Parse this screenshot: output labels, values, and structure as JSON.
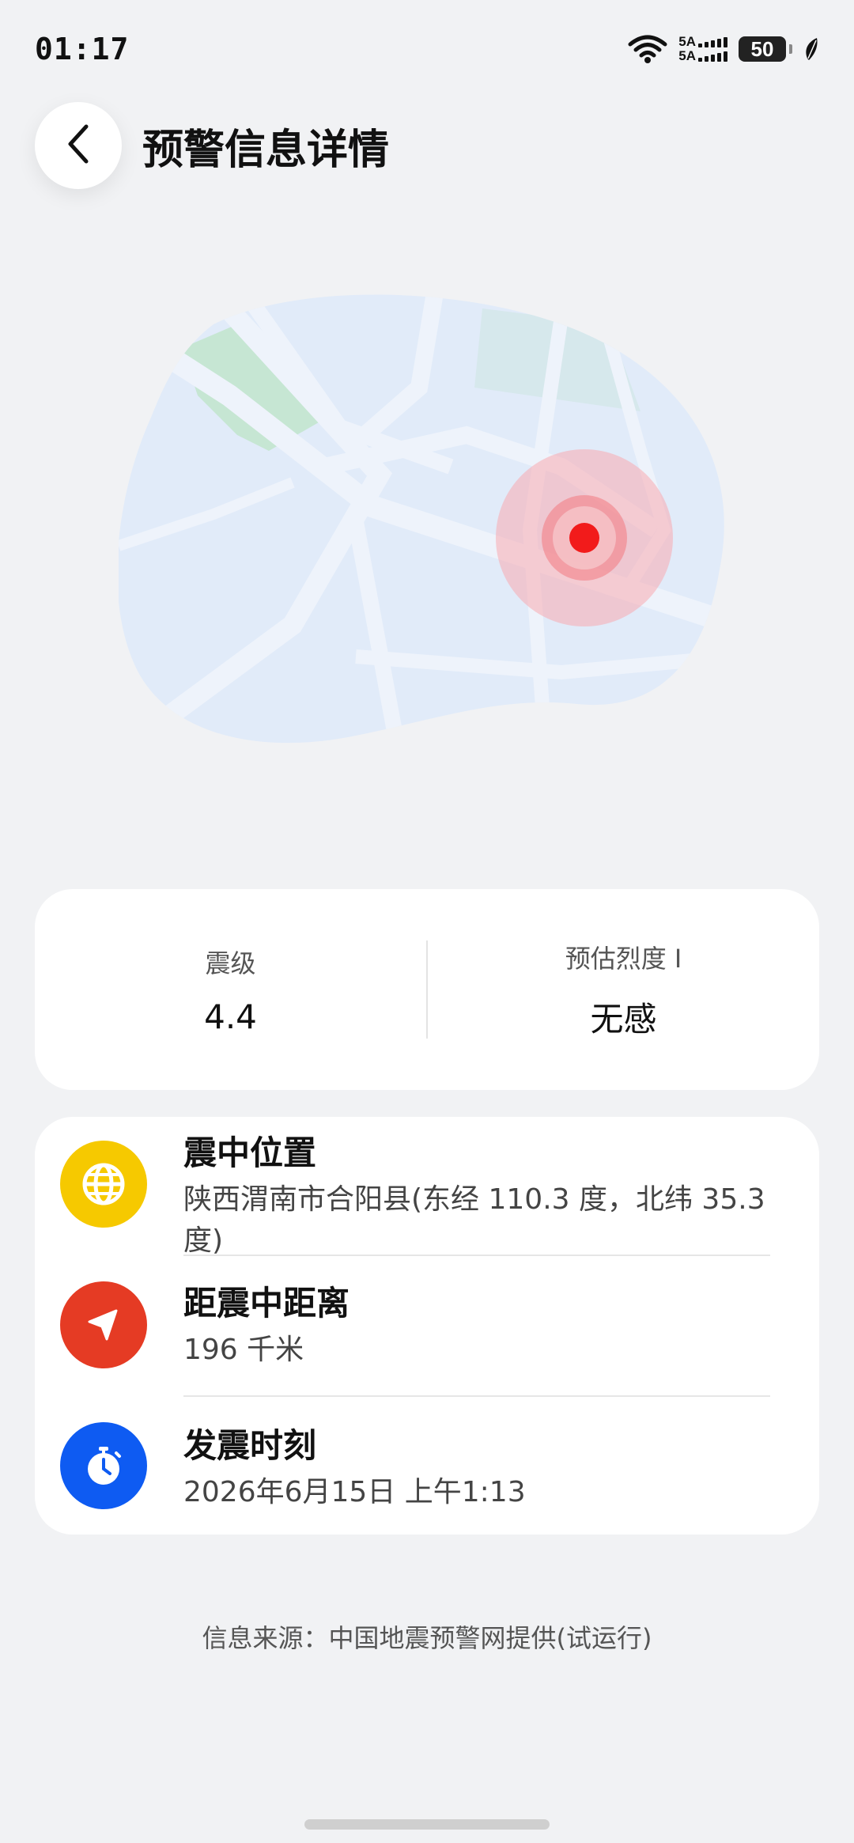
{
  "status_bar": {
    "time": "01:17",
    "signal_1": "5A",
    "signal_2": "5A",
    "battery": "50"
  },
  "header": {
    "title": "预警信息详情"
  },
  "summary": {
    "magnitude_label": "震级",
    "magnitude_value": "4.4",
    "intensity_label": "预估烈度 I",
    "intensity_value": "无感"
  },
  "details": {
    "epicenter_title": "震中位置",
    "epicenter_value": "陕西渭南市合阳县(东经 110.3 度，北纬 35.3 度)",
    "distance_title": "距震中距离",
    "distance_value": "196 千米",
    "time_title": "发震时刻",
    "time_value": "2026年6月15日 上午1:13"
  },
  "footer": {
    "source": "信息来源：中国地震预警网提供(试运行)"
  },
  "colors": {
    "epicenter_icon_bg": "#f6c900",
    "distance_icon_bg": "#e53b24",
    "time_icon_bg": "#0e5bf2",
    "alert_dot": "#f21b1b"
  }
}
